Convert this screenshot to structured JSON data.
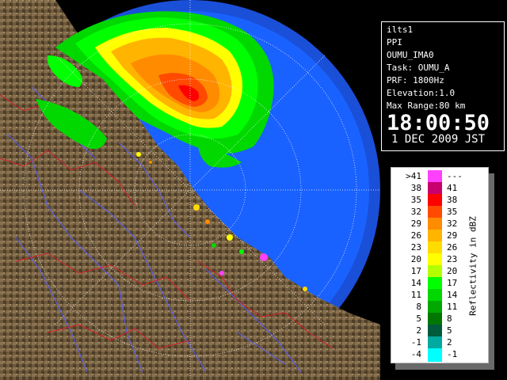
{
  "info": {
    "radar": "ilts1",
    "mode": "PPI",
    "product": "OUMU_IMA0",
    "task": "Task: OUMU_A",
    "prf": "PRF: 1800Hz",
    "elevation": "Elevation:1.0",
    "max_range": "Max Range:80 km",
    "time": "18:00:50",
    "date": "1 DEC 2009 JST"
  },
  "legend": {
    "title": "Reflectivity in dBZ",
    "rows": [
      {
        "low": ">41",
        "high": "---",
        "color": "#ff40ff"
      },
      {
        "low": "38",
        "high": "41",
        "color": "#c8006e"
      },
      {
        "low": "35",
        "high": "38",
        "color": "#ff0000"
      },
      {
        "low": "32",
        "high": "35",
        "color": "#ff4a00"
      },
      {
        "low": "29",
        "high": "32",
        "color": "#ff8c00"
      },
      {
        "low": "26",
        "high": "29",
        "color": "#ffb400"
      },
      {
        "low": "23",
        "high": "26",
        "color": "#ffdc00"
      },
      {
        "low": "20",
        "high": "23",
        "color": "#ffff00"
      },
      {
        "low": "17",
        "high": "20",
        "color": "#b4ff00"
      },
      {
        "low": "14",
        "high": "17",
        "color": "#00ff00"
      },
      {
        "low": "11",
        "high": "14",
        "color": "#00d800"
      },
      {
        "low": "8",
        "high": "11",
        "color": "#00a800"
      },
      {
        "low": "5",
        "high": "8",
        "color": "#007800"
      },
      {
        "low": "2",
        "high": "5",
        "color": "#005a3c"
      },
      {
        "low": "-1",
        "high": "2",
        "color": "#00aaa0"
      },
      {
        "low": "-4",
        "high": "-1",
        "color": "#00ffff"
      }
    ]
  },
  "colors": {
    "sea": "#1a62ff",
    "land": "#6e5a3c",
    "range_ring": "#ffffff"
  }
}
